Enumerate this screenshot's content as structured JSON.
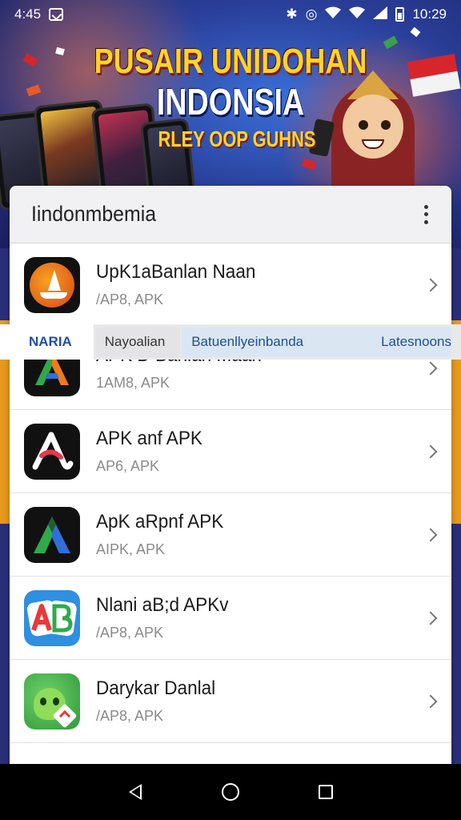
{
  "status_bar": {
    "time_left": "4:45",
    "time_right": "10:29",
    "icons": [
      "notification-icon",
      "bluetooth-icon",
      "data-saver-icon",
      "wifi-icon",
      "wifi-icon",
      "signal-icon",
      "battery-icon"
    ]
  },
  "banner": {
    "line1": "PUSAIR UNIDOHAN",
    "line2": "INDONSIA",
    "line3": "RLEY OOP GUHNS"
  },
  "header": {
    "title": "Iindonmbemia",
    "menu_icon": "more-vert-icon"
  },
  "filter_bar": {
    "label": "NARIA",
    "chips": [
      "Nayoalian",
      "Batuenllyeinbanda",
      "Latesnoons"
    ]
  },
  "apps": [
    {
      "name": "UpK1aBanlan Naan",
      "sub": "/AP8, APK",
      "icon": "sailboat-app-icon"
    },
    {
      "name": "APK D Banian Maan",
      "sub": "1AM8, APK",
      "icon": "green-orange-a-app-icon"
    },
    {
      "name": "APK anf APK",
      "sub": "AP6, APK",
      "icon": "white-a-app-icon"
    },
    {
      "name": "ApK aRpnf APK",
      "sub": "AIPK, APK",
      "icon": "green-blue-a-app-icon"
    },
    {
      "name": "Nlani aB;d APKv",
      "sub": "/AP8, APK",
      "icon": "ab-app-icon"
    },
    {
      "name": "Darykar Danlal",
      "sub": "/AP8, APK",
      "icon": "android-app-icon"
    }
  ],
  "colors": {
    "accent_blue": "#1f4fa8",
    "stripe_orange": "#e89a1f",
    "banner_yellow": "#ffd426"
  }
}
